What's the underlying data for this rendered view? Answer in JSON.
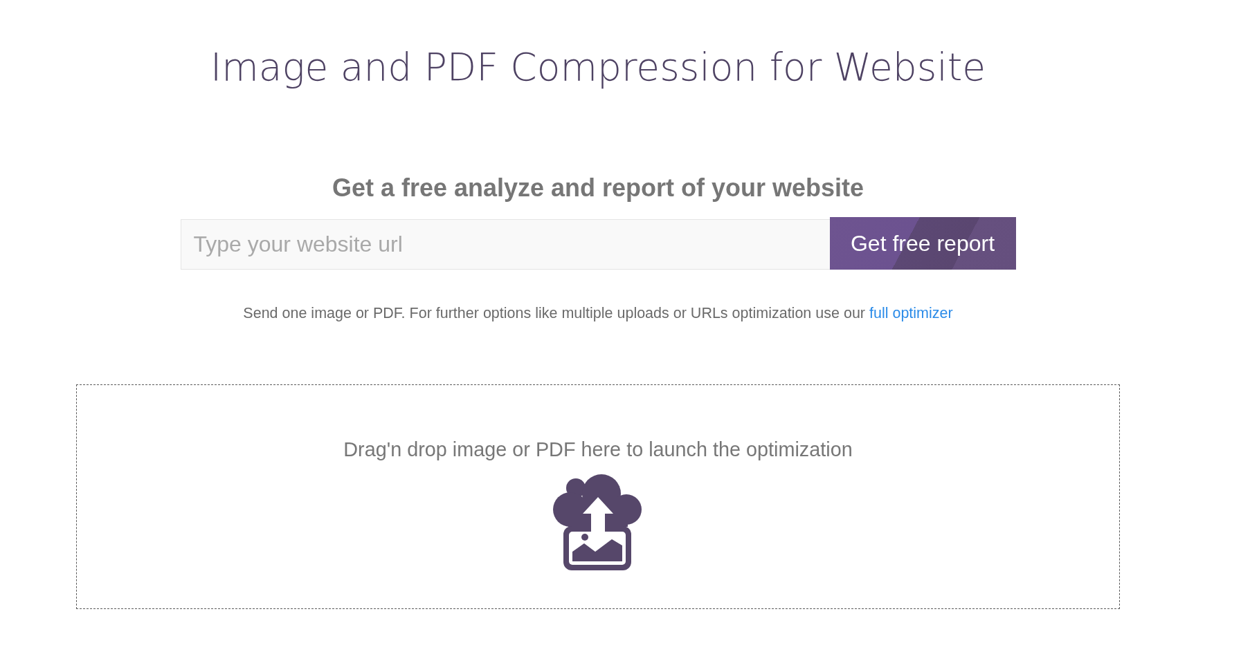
{
  "page": {
    "title": "Image and PDF Compression for Website"
  },
  "report_form": {
    "heading": "Get a free analyze and report of your website",
    "url_field": {
      "placeholder": "Type your website url"
    },
    "submit_button": "Get free report"
  },
  "note": {
    "text": "Send one image or PDF. For further options like multiple uploads or URLs optimization use our",
    "link": "full optimizer"
  },
  "dropzone": {
    "text": "Drag'n drop image or PDF here to launch the optimization"
  }
}
